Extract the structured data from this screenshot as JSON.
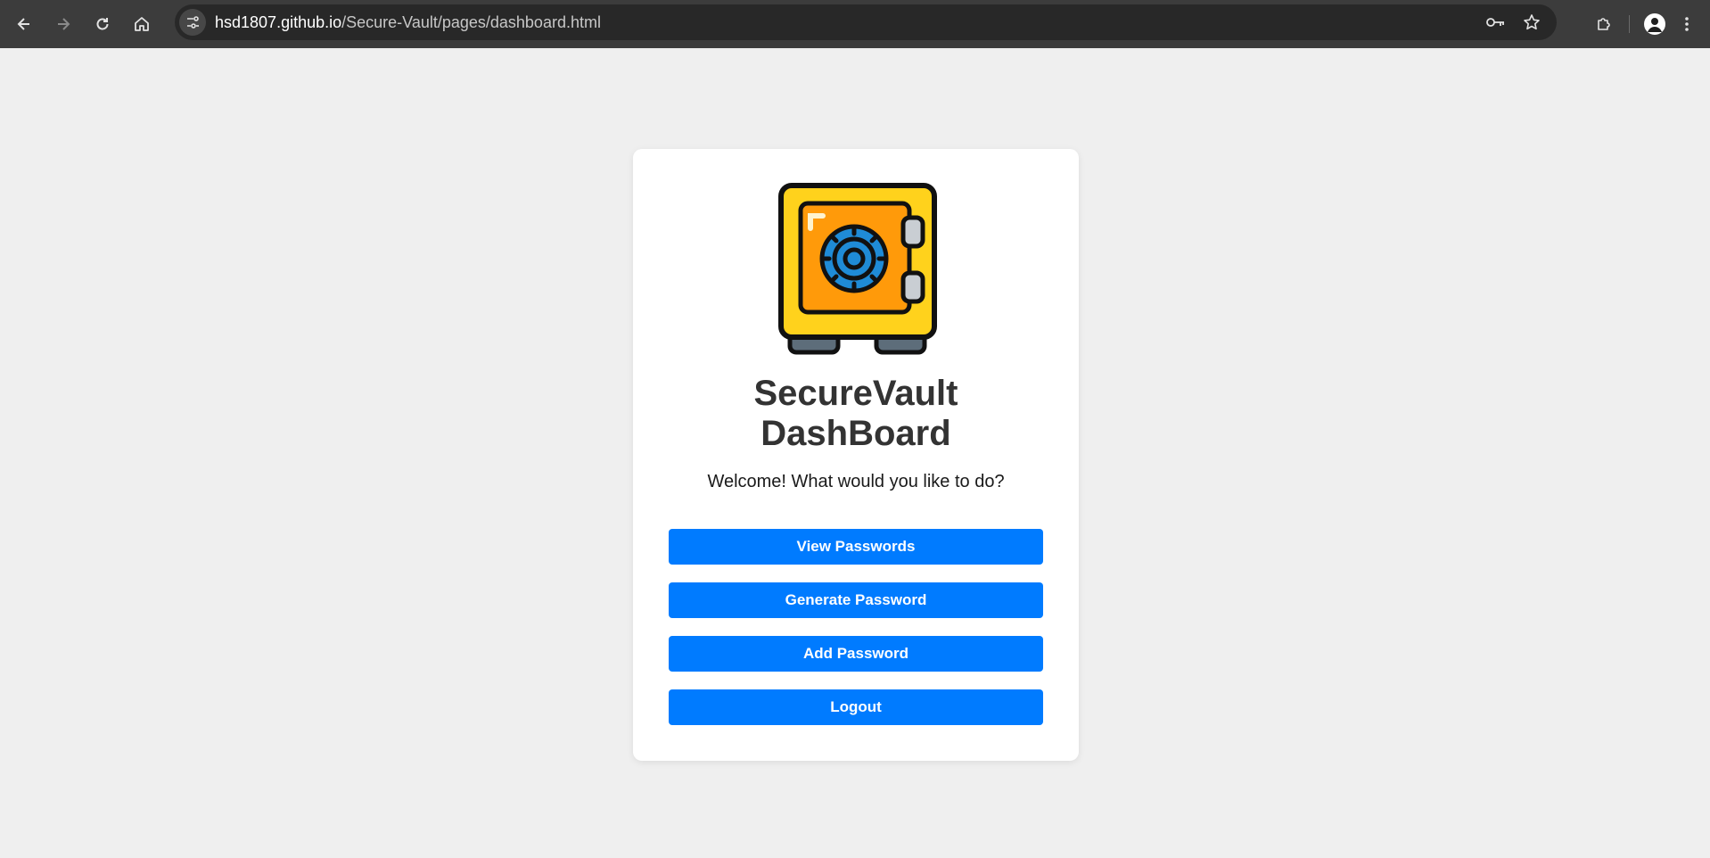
{
  "browser": {
    "url_host": "hsd1807.github.io",
    "url_path": "/Secure-Vault/pages/dashboard.html"
  },
  "dashboard": {
    "title_line1": "SecureVault",
    "title_line2": "DashBoard",
    "welcome": "Welcome! What would you like to do?",
    "buttons": {
      "view": "View Passwords",
      "generate": "Generate Password",
      "add": "Add Password",
      "logout": "Logout"
    }
  },
  "colors": {
    "primary": "#007bff",
    "page_bg": "#efefef",
    "title": "#333333"
  },
  "icons": [
    "back-icon",
    "forward-icon",
    "reload-icon",
    "home-icon",
    "site-info-icon",
    "password-key-icon",
    "bookmark-star-icon",
    "extensions-icon",
    "profile-icon",
    "menu-icon",
    "safe-logo"
  ]
}
